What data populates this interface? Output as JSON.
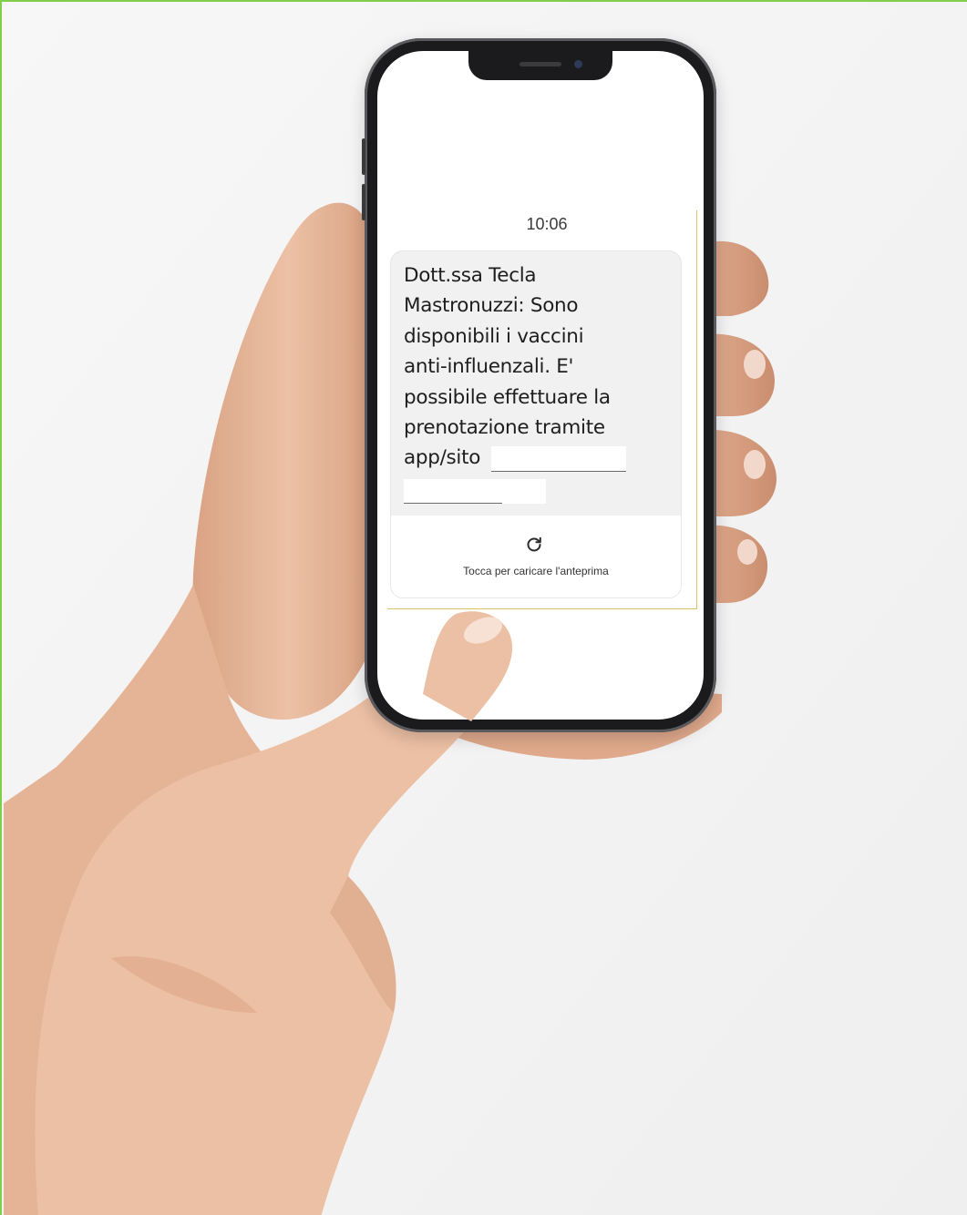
{
  "message": {
    "time": "10:06",
    "lines": [
      "Dott.ssa Tecla",
      "Mastronuzzi: Sono",
      "disponibili i vaccini",
      "anti-influenzali. E'",
      "possibile effettuare la",
      "prenotazione tramite",
      "app/sito"
    ]
  },
  "link_preview": {
    "label": "Tocca per caricare l'anteprima",
    "icon": "refresh-icon"
  },
  "colors": {
    "frame_accent": "#7fcf4a",
    "bubble_bg": "#f1f1f1",
    "text": "#1e1e1e",
    "phone_body": "#1b1b1d",
    "skin": "#e8b99b"
  }
}
